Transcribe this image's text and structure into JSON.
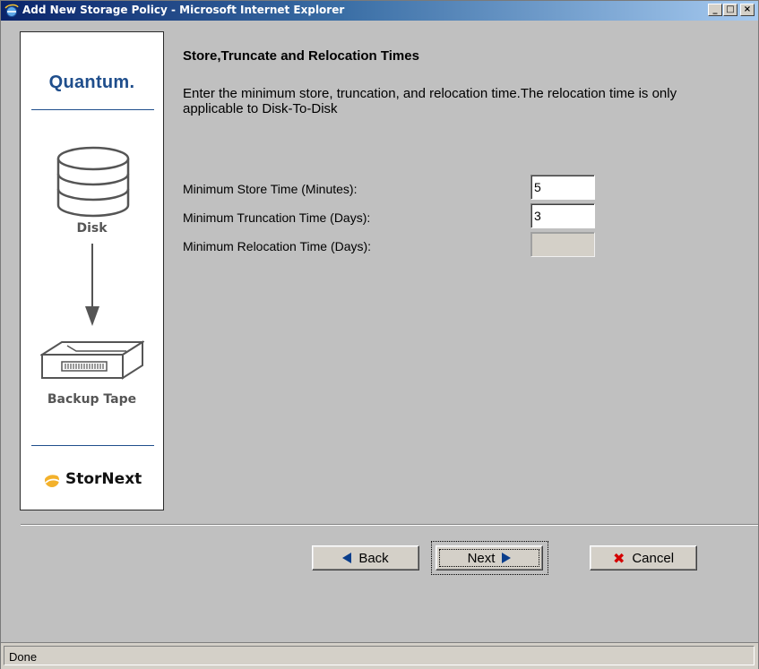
{
  "window": {
    "title": "Add New Storage Policy - Microsoft Internet Explorer",
    "controls": {
      "minimize": "_",
      "maximize": "□",
      "close": "×"
    }
  },
  "sidebar": {
    "brand": "Quantum.",
    "source_label": "Disk",
    "target_label": "Backup Tape",
    "product": "StorNext"
  },
  "main": {
    "heading": "Store,Truncate and Relocation Times",
    "description": "Enter the minimum store, truncation, and relocation time.The relocation time is only applicable to Disk-To-Disk",
    "fields": [
      {
        "label": "Minimum Store Time (Minutes):",
        "value": "5",
        "enabled": true
      },
      {
        "label": "Minimum Truncation Time (Days):",
        "value": "3",
        "enabled": true
      },
      {
        "label": "Minimum Relocation Time (Days):",
        "value": "",
        "enabled": false
      }
    ]
  },
  "buttons": {
    "back": "Back",
    "next": "Next",
    "cancel": "Cancel"
  },
  "status": {
    "text": "Done"
  },
  "colors": {
    "brand_blue": "#1f4e8c",
    "arrow_blue": "#0a3e8c",
    "cancel_red": "#d40000"
  }
}
